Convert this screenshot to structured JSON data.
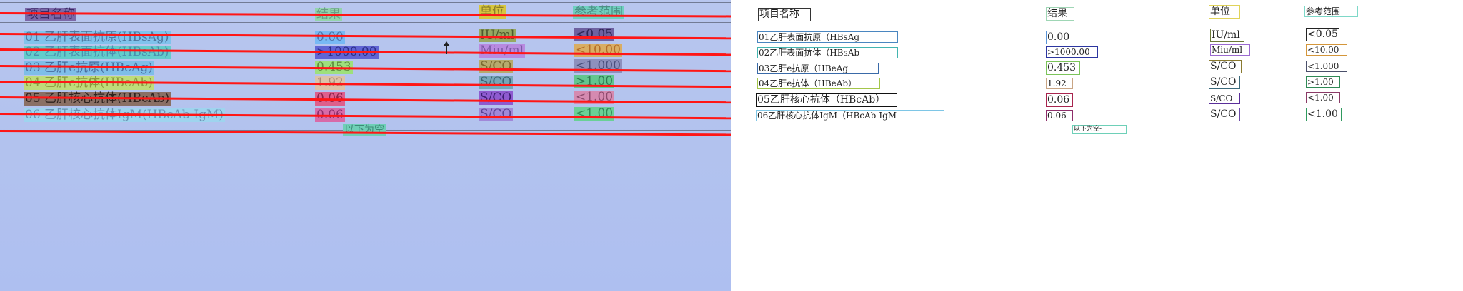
{
  "photo": {
    "header": {
      "name": "项目名称",
      "result": "结果",
      "unit": "单位",
      "range": "参考范围"
    },
    "rows": [
      {
        "name": "01 乙肝表面抗原(HBsAg)",
        "result": "0.00",
        "unit": "IU/ml",
        "range": "<0.05"
      },
      {
        "name": "02 乙肝表面抗体(HBsAb)",
        "result": ">1000.00",
        "unit": "Miu/ml",
        "range": "<10.00"
      },
      {
        "name": "03 乙肝e抗原(HBeAg)",
        "result": "0.453",
        "unit": "S/CO",
        "range": "<1.000"
      },
      {
        "name": "04 乙肝e抗体(HBeAb)",
        "result": "1.92",
        "unit": "S/CO",
        "range": ">1.00"
      },
      {
        "name": "05 乙肝核心抗体(HBcAb)",
        "result": "0.06",
        "unit": "S/CO",
        "range": "<1.00"
      },
      {
        "name": "06 乙肝核心抗体IgM(HBcAb-IgM)",
        "result": "0.06",
        "unit": "S/CO",
        "range": "<1.00"
      }
    ],
    "footer": "以下为空"
  },
  "render": {
    "header": {
      "name": "项目名称",
      "result": "结果",
      "unit": "单位",
      "range": "参考范围"
    },
    "rows": [
      {
        "name": "01乙肝表面抗原（HBsAg",
        "result": "0.00",
        "unit": "IU/ml",
        "range": "<0.05"
      },
      {
        "name": "02乙肝表面抗体（HBsAb",
        "result": ">1000.00",
        "unit": "Miu/ml",
        "range": "<10.00"
      },
      {
        "name": "03乙肝e抗原（HBeAg",
        "result": "0.453",
        "unit": "S/CO",
        "range": "<1.000"
      },
      {
        "name": "04乙肝e抗体（HBeAb）",
        "result": "1.92",
        "unit": "S/CO",
        "range": ">1.00"
      },
      {
        "name": "05乙肝核心抗体（HBcAb）",
        "result": "0.06",
        "unit": "S/CO",
        "range": "<1.00"
      },
      {
        "name": "06乙肝核心抗体IgM（HBcAb-IgM",
        "result": "0.06",
        "unit": "S/CO",
        "range": "<1.00"
      }
    ],
    "footer": "以下为空-"
  },
  "colors": {
    "photo_background": "#b3c3ee",
    "red_line": "#ff1616",
    "header_name": "#7b68a8",
    "header_result": "#94d4ad",
    "header_unit": "#d7c63e",
    "header_range": "#6fd0bf"
  }
}
